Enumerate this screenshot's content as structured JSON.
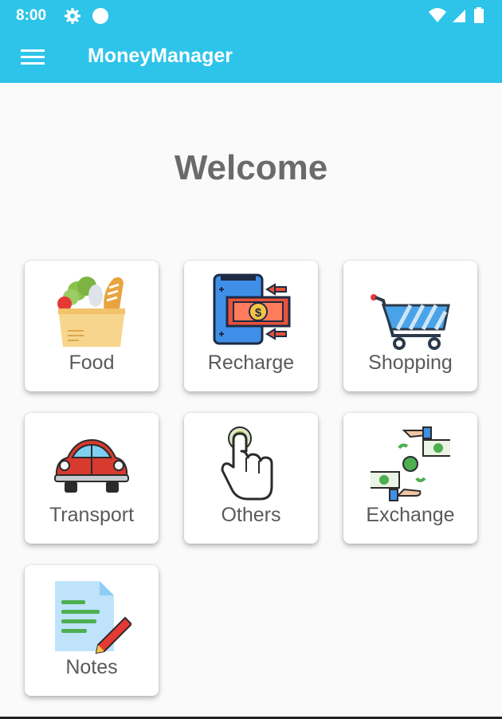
{
  "status_bar": {
    "time": "8:00",
    "icons": [
      "gear-icon",
      "circle-icon",
      "wifi-icon",
      "signal-icon",
      "battery-icon"
    ]
  },
  "app_bar": {
    "menu_icon": "menu-icon",
    "title": "MoneyManager",
    "color": "#2ec4ea"
  },
  "welcome": "Welcome",
  "categories": [
    {
      "label": "Food",
      "icon": "food-bag-icon"
    },
    {
      "label": "Recharge",
      "icon": "recharge-icon"
    },
    {
      "label": "Shopping",
      "icon": "shopping-cart-icon"
    },
    {
      "label": "Transport",
      "icon": "car-icon"
    },
    {
      "label": "Others",
      "icon": "pointer-hand-icon"
    },
    {
      "label": "Exchange",
      "icon": "exchange-icon"
    },
    {
      "label": "Notes",
      "icon": "notes-icon"
    }
  ]
}
